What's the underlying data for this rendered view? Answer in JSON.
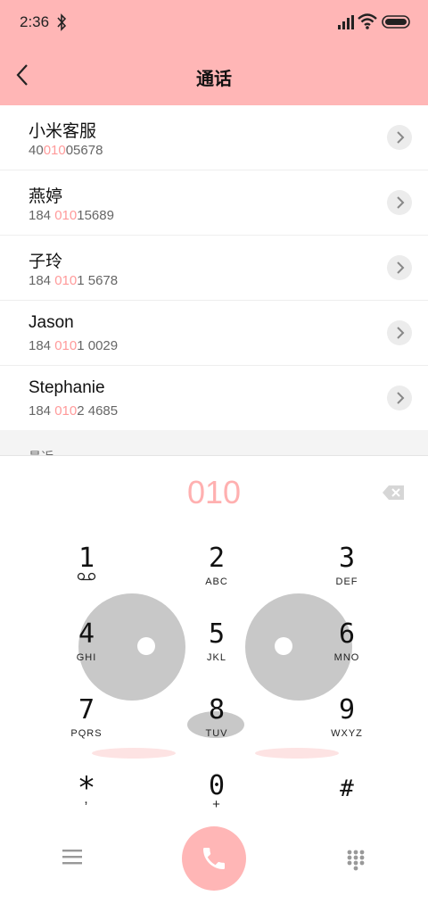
{
  "status_bar": {
    "time": "2:36"
  },
  "header": {
    "title": "通话"
  },
  "contacts": [
    {
      "name": "小米客服",
      "num_pre": "40",
      "num_hl": "010",
      "num_post": "05678"
    },
    {
      "name": "燕婷",
      "num_pre": "184 ",
      "num_hl": "010",
      "num_post": "15689"
    },
    {
      "name": "子玲",
      "num_pre": "184 ",
      "num_hl": "010",
      "num_post": "1 5678"
    },
    {
      "name": "Jason",
      "num_pre": "184 ",
      "num_hl": "010",
      "num_post": "1 0029"
    },
    {
      "name": "Stephanie",
      "num_pre": "184 ",
      "num_hl": "010",
      "num_post": "2 4685"
    }
  ],
  "group_label": "最近",
  "dialer": {
    "number": "010",
    "keys": [
      {
        "digit": "1",
        "letters": ""
      },
      {
        "digit": "2",
        "letters": "ABC"
      },
      {
        "digit": "3",
        "letters": "DEF"
      },
      {
        "digit": "4",
        "letters": "GHI"
      },
      {
        "digit": "5",
        "letters": "JKL"
      },
      {
        "digit": "6",
        "letters": "MNO"
      },
      {
        "digit": "7",
        "letters": "PQRS"
      },
      {
        "digit": "8",
        "letters": "TUV"
      },
      {
        "digit": "9",
        "letters": "WXYZ"
      },
      {
        "digit": "*",
        "letters": ","
      },
      {
        "digit": "0",
        "letters": "+"
      },
      {
        "digit": "#",
        "letters": ""
      }
    ]
  },
  "colors": {
    "accent": "#ffb6b6",
    "highlight": "#ff9a9a",
    "key_text": "#111111"
  },
  "icons": [
    "bluetooth-icon",
    "signal-icon",
    "wifi-icon",
    "battery-icon",
    "back-icon",
    "chevron-right-icon",
    "backspace-icon",
    "voicemail-icon",
    "menu-icon",
    "phone-icon",
    "keypad-icon"
  ]
}
